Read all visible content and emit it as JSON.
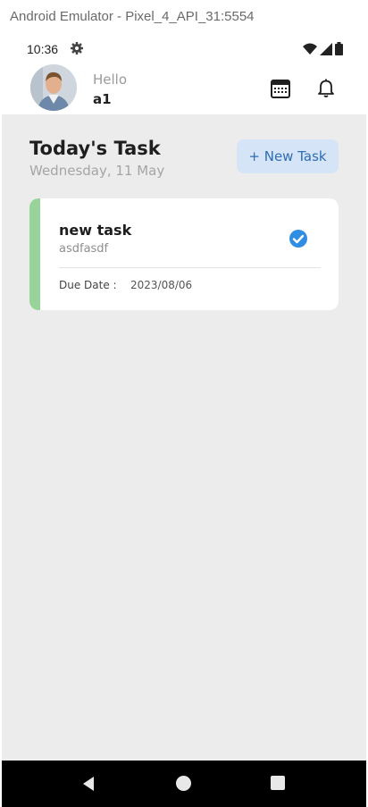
{
  "window": {
    "title": "Android Emulator - Pixel_4_API_31:5554"
  },
  "status_bar": {
    "time": "10:36",
    "icons": [
      "gear-icon",
      "wifi-icon",
      "signal-icon",
      "battery-icon"
    ]
  },
  "header": {
    "greeting": "Hello",
    "username": "a1",
    "icons": [
      "calendar-icon",
      "bell-icon"
    ]
  },
  "tasks_section": {
    "title": "Today's Task",
    "date": "Wednesday, 11 May",
    "new_task_label": "+ New Task"
  },
  "task_card": {
    "name": "new task",
    "description": "asdfasdf",
    "due_label": "Due Date :",
    "due_value": "2023/08/06",
    "completed": true,
    "accent_color": "#98d49a"
  },
  "nav_bar": {
    "buttons": [
      "back-icon",
      "home-icon",
      "recents-icon"
    ]
  },
  "colors": {
    "accent": "#2f6db4",
    "button_bg": "#d5e5f7",
    "check": "#2f8de4",
    "background": "#ececec"
  }
}
